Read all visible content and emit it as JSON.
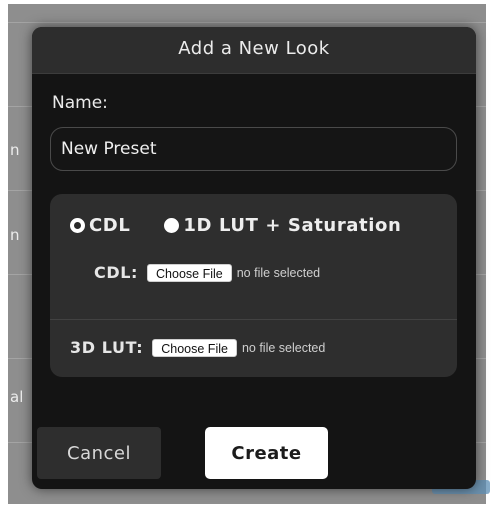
{
  "background": {
    "fragments": [
      "n",
      "n",
      "al"
    ]
  },
  "dialog": {
    "title": "Add a New Look",
    "name_label": "Name:",
    "name_value": "New Preset",
    "mode_options": [
      {
        "label": "CDL",
        "selected": true
      },
      {
        "label": "1D LUT + Saturation",
        "selected": false
      }
    ],
    "cdl": {
      "label": "CDL:",
      "button_label": "Choose File",
      "status": "no file selected"
    },
    "lut3d": {
      "label": "3D LUT:",
      "button_label": "Choose File",
      "status": "no file selected"
    },
    "cancel_label": "Cancel",
    "create_label": "Create"
  },
  "colors": {
    "modal_bg": "#141414",
    "header_bg": "#2d2d2d",
    "panel_bg": "#2e2e2e",
    "backdrop": "#8e8e8e"
  }
}
